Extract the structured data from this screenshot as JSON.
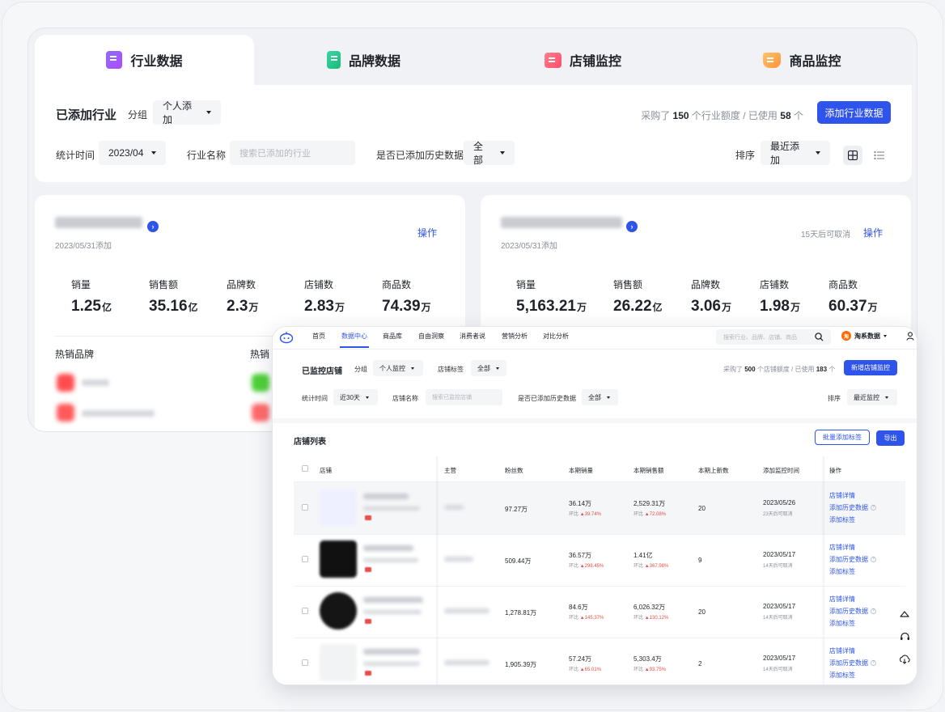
{
  "back": {
    "tabs": [
      {
        "label": "行业数据",
        "icon": "document-icon",
        "color": "#8b6cff"
      },
      {
        "label": "品牌数据",
        "icon": "phone-icon",
        "color": "#23c88a"
      },
      {
        "label": "店铺监控",
        "icon": "store-icon",
        "color": "#ff5a72"
      },
      {
        "label": "商品监控",
        "icon": "cart-icon",
        "color": "#ffa541"
      }
    ],
    "filter": {
      "title": "已添加行业",
      "group_label": "分组",
      "group_value": "个人添加",
      "quota_prefix": "采购了",
      "quota_total": "150",
      "quota_mid": "个行业额度 / 已使用",
      "quota_used": "58",
      "quota_suffix": "个",
      "add_button": "添加行业数据",
      "time_label": "统计时间",
      "time_value": "2023/04",
      "name_label": "行业名称",
      "name_placeholder": "搜索已添加的行业",
      "history_label": "是否已添加历史数据",
      "history_value": "全部",
      "sort_label": "排序",
      "sort_value": "最近添加"
    },
    "cards": [
      {
        "date": "2023/05/31添加",
        "note": "",
        "op": "操作",
        "metrics": [
          {
            "label": "销量",
            "value": "1.25",
            "unit": "亿"
          },
          {
            "label": "销售额",
            "value": "35.16",
            "unit": "亿"
          },
          {
            "label": "品牌数",
            "value": "2.3",
            "unit": "万"
          },
          {
            "label": "店铺数",
            "value": "2.83",
            "unit": "万"
          },
          {
            "label": "商品数",
            "value": "74.39",
            "unit": "万"
          }
        ],
        "hot_brand": "热销品牌",
        "hot_other": "热销"
      },
      {
        "date": "2023/05/31添加",
        "note": "15天后可取消",
        "op": "操作",
        "metrics": [
          {
            "label": "销量",
            "value": "5,163.21",
            "unit": "万"
          },
          {
            "label": "销售额",
            "value": "26.22",
            "unit": "亿"
          },
          {
            "label": "品牌数",
            "value": "3.06",
            "unit": "万"
          },
          {
            "label": "店铺数",
            "value": "1.98",
            "unit": "万"
          },
          {
            "label": "商品数",
            "value": "60.37",
            "unit": "万"
          }
        ]
      }
    ]
  },
  "front": {
    "nav": [
      "首页",
      "数据中心",
      "商品库",
      "自由洞察",
      "消费者说",
      "营销分析",
      "对比分析"
    ],
    "nav_search_placeholder": "搜索行业、品牌、店铺、商品",
    "brand": "淘系数据",
    "brand_badge": "淘",
    "filter": {
      "title": "已监控店铺",
      "group_label": "分组",
      "group_value": "个人监控",
      "tag_label": "店铺标签",
      "tag_value": "全部",
      "quota_prefix": "采购了",
      "quota_total": "500",
      "quota_mid": "个店铺额度 / 已使用",
      "quota_used": "183",
      "quota_suffix": "个",
      "add_button": "新增店铺监控",
      "time_label": "统计时间",
      "time_value": "近30天",
      "name_label": "店铺名称",
      "name_placeholder": "搜索已监控店铺",
      "history_label": "是否已添加历史数据",
      "history_value": "全部",
      "sort_label": "排序",
      "sort_value": "最近监控"
    },
    "list": {
      "title": "店铺列表",
      "batch_button": "批量添加标签",
      "export_button": "导出",
      "columns": [
        "店铺",
        "主营",
        "粉丝数",
        "本期销量",
        "本期销售额",
        "本期上新数",
        "添加监控时间",
        "操作"
      ],
      "rows": [
        {
          "fans": "97.27万",
          "sales": "36.14万",
          "sales_change": "39.74%",
          "revenue": "2,529.31万",
          "revenue_change": "72.08%",
          "new": "20",
          "date": "2023/05/26",
          "cancel": "23天后可取消"
        },
        {
          "fans": "509.44万",
          "sales": "36.57万",
          "sales_change": "298.45%",
          "revenue": "1.41亿",
          "revenue_change": "367.98%",
          "new": "9",
          "date": "2023/05/17",
          "cancel": "14天后可取消"
        },
        {
          "fans": "1,278.81万",
          "sales": "84.6万",
          "sales_change": "145.37%",
          "revenue": "6,026.32万",
          "revenue_change": "130.12%",
          "new": "20",
          "date": "2023/05/17",
          "cancel": "14天后可取消"
        },
        {
          "fans": "1,905.39万",
          "sales": "57.24万",
          "sales_change": "65.01%",
          "revenue": "5,303.4万",
          "revenue_change": "93.75%",
          "new": "2",
          "date": "2023/05/17",
          "cancel": "14天后可取消"
        }
      ],
      "change_prefix": "环比",
      "actions": [
        "店铺详情",
        "添加历史数据",
        "添加标签"
      ]
    }
  }
}
